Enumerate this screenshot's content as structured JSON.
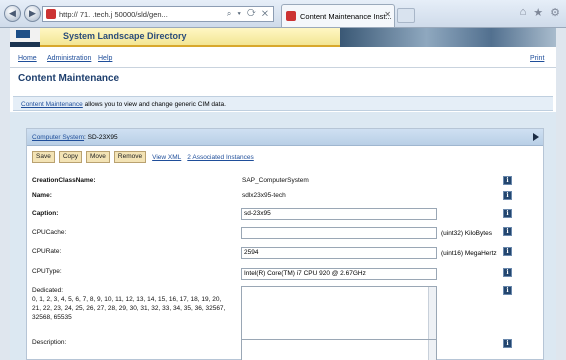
{
  "browser": {
    "address": "http://       71.        .tech.j       50000/sld/gen...",
    "address_controls": "⌕ ▾ ⟳ ✕",
    "tab_title": "Content Maintenance Inst...",
    "tab_close": "✕",
    "icons": [
      "home-icon",
      "star-icon",
      "gear-icon"
    ]
  },
  "banner": {
    "title": "System Landscape Directory"
  },
  "topnav": {
    "home": "Home",
    "administration": "Administration",
    "help": "Help",
    "print": "Print"
  },
  "page": {
    "heading": "Content Maintenance"
  },
  "infobar": {
    "link": "Content Maintenance",
    "text": " allows you to view and change generic CIM data."
  },
  "panel": {
    "header_link": "Computer System",
    "header_value": ": SD-23X95"
  },
  "buttons": {
    "save": "Save",
    "copy": "Copy",
    "move": "Move",
    "remove": "Remove",
    "view_xml": "View XML",
    "associated": "2 Associated Instances"
  },
  "fields": {
    "creation_class_label": "CreationClassName:",
    "creation_class_value": "SAP_ComputerSystem",
    "name_label": "Name:",
    "name_value": "sdlx23x95-tech",
    "caption_label": "Caption:",
    "caption_value": "sd-23x95",
    "cpucache_label": "CPUCache:",
    "cpucache_value": "",
    "cpucache_unit": "(uint32) KiloBytes",
    "cpurate_label": "CPURate:",
    "cpurate_value": "2594",
    "cpurate_unit": "(uint16) MegaHertz",
    "cputype_label": "CPUType:",
    "cputype_value": "Intel(R) Core(TM) i7 CPU 920 @ 2.67GHz",
    "dedicated_label": "Dedicated:",
    "dedicated_values": "0, 1, 2, 3, 4, 5, 6, 7, 8, 9, 10, 11, 12, 13, 14, 15, 16, 17, 18, 19, 20, 21, 22, 23, 24, 25, 26, 27, 28, 29, 30, 31, 32, 33, 34, 35, 36, 32567, 32568, 65535",
    "description_label": "Description:"
  },
  "info_glyph": "i",
  "colors": {
    "banner": "#1d3551",
    "link": "#1f4e9a",
    "button_fill": "#f3e3b5",
    "panel_header": "#c4d7ec"
  }
}
